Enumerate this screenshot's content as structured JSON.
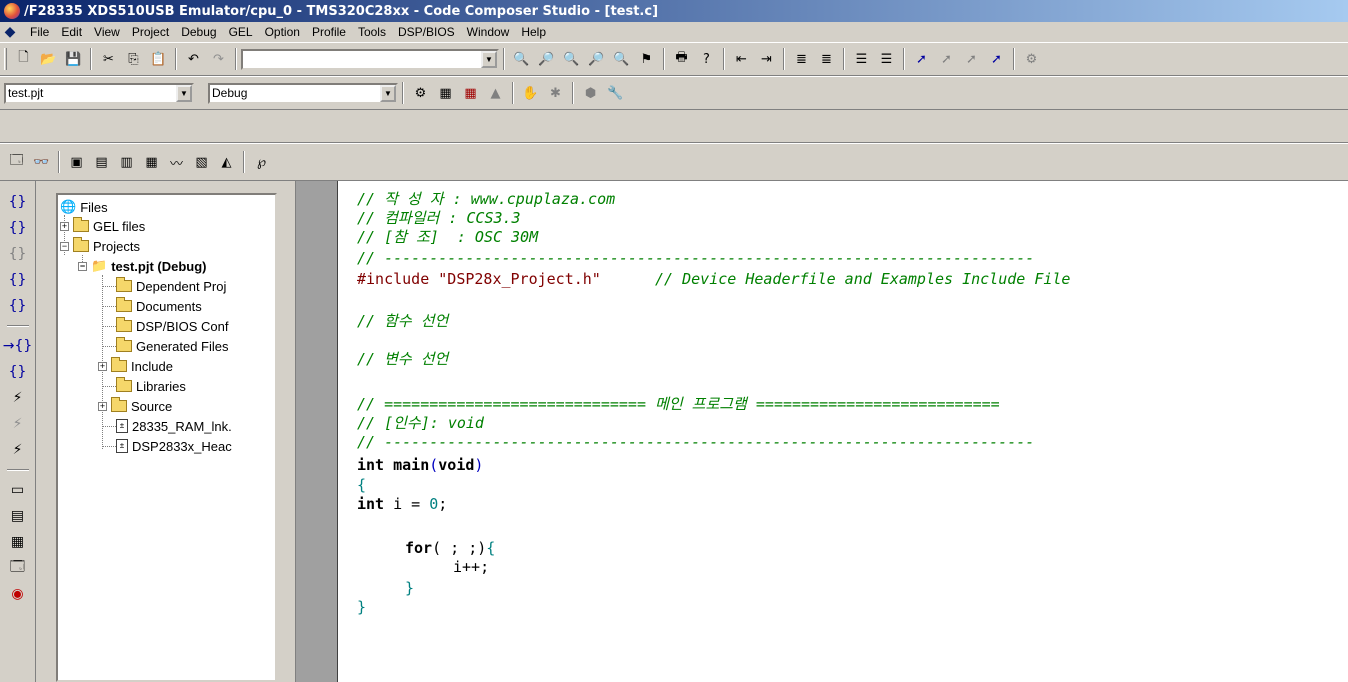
{
  "window": {
    "title": "/F28335 XDS510USB Emulator/cpu_0 - TMS320C28xx - Code Composer Studio - [test.c]"
  },
  "menu": [
    "File",
    "Edit",
    "View",
    "Project",
    "Debug",
    "GEL",
    "Option",
    "Profile",
    "Tools",
    "DSP/BIOS",
    "Window",
    "Help"
  ],
  "toolbar2": {
    "project_combo": "test.pjt",
    "config_combo": "Debug"
  },
  "tree": {
    "root": "Files",
    "gel_files": "GEL files",
    "projects": "Projects",
    "project": "test.pjt (Debug)",
    "items": [
      "Dependent Proj",
      "Documents",
      "DSP/BIOS Conf",
      "Generated Files",
      "Include",
      "Libraries",
      "Source",
      "28335_RAM_lnk.",
      "DSP2833x_Heac"
    ]
  },
  "code": {
    "l1": "// 작 성 자 : www.cpuplaza.com",
    "l2": "// 컴파일러 : CCS3.3",
    "l3": "// [참 조]  : OSC 30M",
    "l4": "// ------------------------------------------------------------------------",
    "l5_pp": "#include \"DSP28x_Project.h\"",
    "l5_cm": "// Device Headerfile and Examples Include File",
    "l6": "// 함수 선언",
    "l7": "// 변수 선언",
    "l8": "// ============================= 메인 프로그램 ===========================",
    "l9": "// [인수]: void",
    "l10": "// ------------------------------------------------------------------------",
    "main_kw": "int",
    "main_name": "main",
    "main_arg": "void",
    "open_brace": "{",
    "decl_kw": "int",
    "decl_rest": " i = ",
    "decl_num": "0",
    "decl_end": ";",
    "for_kw": "for",
    "for_rest": "( ; ;)",
    "for_brace": "{",
    "inc": "i++;",
    "inner_close": "}",
    "close_brace": "}"
  }
}
